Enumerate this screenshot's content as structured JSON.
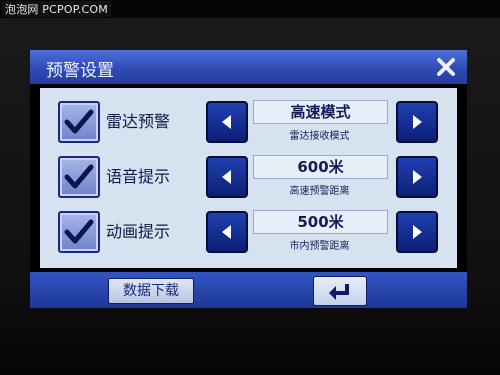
{
  "watermark": "泡泡网 PCPOP.COM",
  "window": {
    "title": "预警设置"
  },
  "rows": [
    {
      "checked": true,
      "label": "雷达预警",
      "value": "高速模式",
      "sublabel": "雷达接收模式"
    },
    {
      "checked": true,
      "label": "语音提示",
      "value": "600米",
      "sublabel": "高速预警距离"
    },
    {
      "checked": true,
      "label": "动画提示",
      "value": "500米",
      "sublabel": "市内预警距离"
    }
  ],
  "footer": {
    "download_label": "数据下载"
  },
  "icons": {
    "close": "close-icon",
    "check": "checkmark-icon",
    "left": "arrow-left-icon",
    "right": "arrow-right-icon",
    "enter": "enter-return-icon"
  },
  "colors": {
    "titlebar": "#2f4bb4",
    "panel": "#d7e2f0",
    "button": "#0c1f77",
    "text": "#10174a"
  }
}
